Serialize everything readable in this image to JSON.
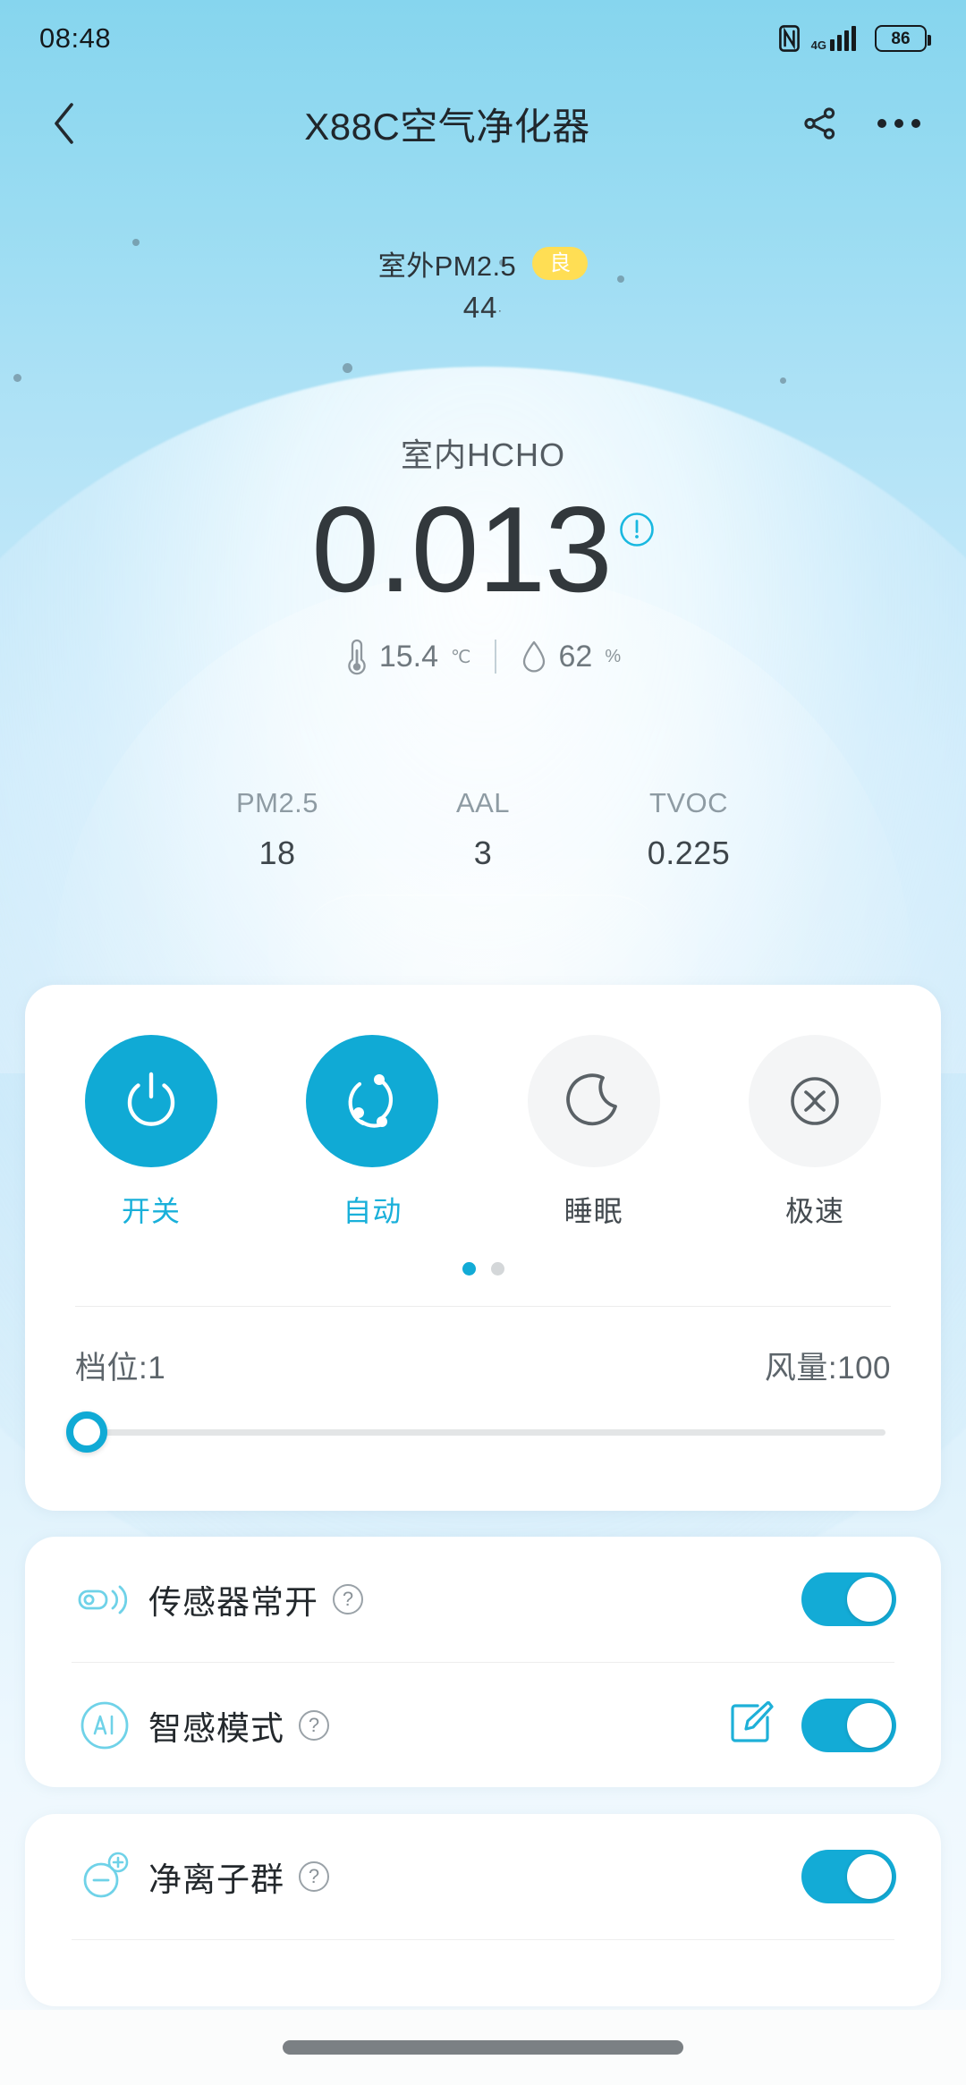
{
  "status_bar": {
    "time": "08:48",
    "nfc_icon": "nfc-icon",
    "signal_icon": "signal-bars-icon",
    "signal_label": "4G",
    "battery_level": "86"
  },
  "app_bar": {
    "back_icon": "back-chevron-icon",
    "title": "X88C空气净化器",
    "share_icon": "share-icon",
    "more_icon": "more-options-icon"
  },
  "outdoor": {
    "label": "室外PM2.5",
    "quality_badge": "良",
    "badge_color": "#ffde54",
    "value": "44"
  },
  "indoor": {
    "label": "室内HCHO",
    "value": "0.013",
    "warning_icon": "alert-circle-icon",
    "warning_color": "#19b8e0",
    "temperature_icon": "thermometer-icon",
    "temperature": "15.4",
    "temperature_unit": "℃",
    "humidity_icon": "humidity-droplet-icon",
    "humidity": "62",
    "humidity_unit": "%"
  },
  "metrics": [
    {
      "label": "PM2.5",
      "value": "18"
    },
    {
      "label": "AAL",
      "value": "3"
    },
    {
      "label": "TVOC",
      "value": "0.225"
    }
  ],
  "control_card": {
    "modes": [
      {
        "label": "开关",
        "icon": "power-icon",
        "active": true
      },
      {
        "label": "自动",
        "icon": "auto-orbit-icon",
        "active": true
      },
      {
        "label": "睡眠",
        "icon": "moon-icon",
        "active": false
      },
      {
        "label": "极速",
        "icon": "turbo-fan-icon",
        "active": false
      }
    ],
    "pagination": {
      "total": 2,
      "active_index": 0
    },
    "gear_label": "档位:1",
    "airflow_label": "风量:100",
    "slider_value": 0,
    "accent_color": "#10aad5"
  },
  "toggle_rows": [
    {
      "icon": "sensor-signal-icon",
      "label": "传感器常开",
      "help_icon": "help-question-icon",
      "help_glyph": "?",
      "has_edit": false,
      "edit_icon": "",
      "toggle_on": true
    },
    {
      "icon": "ai-circle-icon",
      "label": "智感模式",
      "help_icon": "help-question-icon",
      "help_glyph": "?",
      "has_edit": true,
      "edit_icon": "edit-pencil-icon",
      "toggle_on": true
    }
  ],
  "ion_row": {
    "icon": "ion-cluster-icon",
    "label": "净离子群",
    "help_icon": "help-question-icon",
    "help_glyph": "?",
    "toggle_on": true
  },
  "nav_bar": {
    "home_indicator": "home-indicator"
  }
}
